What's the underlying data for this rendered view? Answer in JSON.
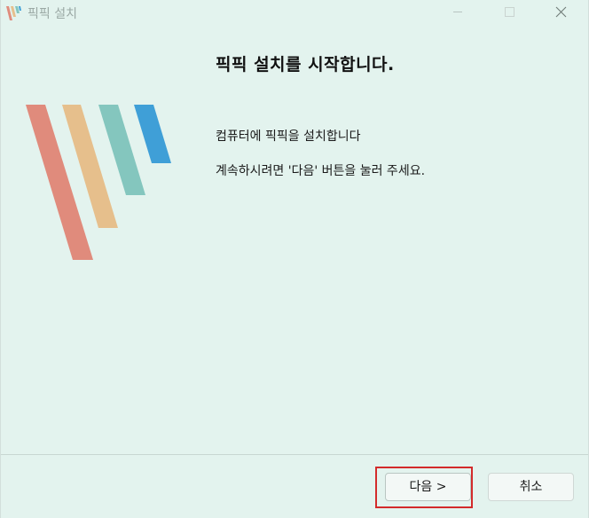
{
  "window": {
    "title": "픽픽 설치"
  },
  "content": {
    "heading": "픽픽 설치를 시작합니다.",
    "line1": "컴퓨터에 픽픽을 설치합니다",
    "line2": "계속하시려면 '다음' 버튼을 눌러 주세요."
  },
  "buttons": {
    "next": "다음 >",
    "cancel": "취소"
  },
  "colors": {
    "background": "#e3f3ee",
    "logo_red": "#e08b7c",
    "logo_orange": "#e6bf8c",
    "logo_teal": "#84c6be",
    "logo_blue": "#3f9fd7",
    "highlight": "#d32b2b"
  },
  "icons": {
    "app": "picpick-logo-icon",
    "minimize": "minimize-icon",
    "maximize": "maximize-icon",
    "close": "close-icon"
  }
}
